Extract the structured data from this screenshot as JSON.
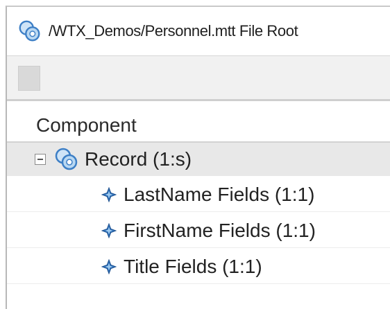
{
  "window": {
    "title": "/WTX_Demos/Personnel.mtt File Root"
  },
  "tree": {
    "column_header": "Component",
    "root": {
      "label": "Record (1:s)",
      "expanded": true,
      "icon": "group-icon"
    },
    "children": [
      {
        "label": "LastName Fields (1:1)",
        "icon": "field-icon"
      },
      {
        "label": "FirstName Fields (1:1)",
        "icon": "field-icon"
      },
      {
        "label": "Title Fields (1:1)",
        "icon": "field-icon"
      }
    ]
  },
  "colors": {
    "icon_blue": "#3d7fc6",
    "icon_light": "#b9d8f2",
    "selection": "#e8e8e8",
    "toolbar": "#f1f1f1"
  }
}
